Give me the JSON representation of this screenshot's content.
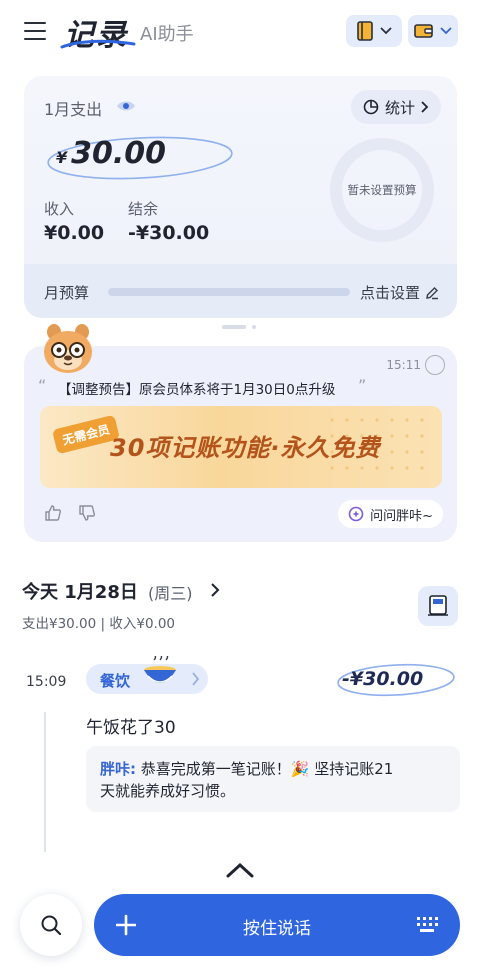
{
  "header": {
    "title": "记录",
    "ai_tab": "AI助手"
  },
  "summary": {
    "expense_label": "1月支出",
    "stats_label": "统计",
    "currency": "¥",
    "expense_amount": "30.00",
    "income_label": "收入",
    "income_value": "¥0.00",
    "balance_label": "结余",
    "balance_value": "-¥30.00",
    "budget_ring_text": "暂未设置预算",
    "monthly_budget_label": "月预算",
    "set_budget_label": "点击设置"
  },
  "assistant_card": {
    "time": "15:11",
    "notice": "【调整预告】原会员体系将于1月30日0点升级",
    "banner_badge": "无需会员",
    "banner_text": "30项记账功能·永久免费",
    "ask_button": "问问胖咔~"
  },
  "day": {
    "title": "今天 1月28日",
    "weekday": "(周三)",
    "summary": "支出¥30.00 | 收入¥0.00"
  },
  "entry": {
    "time": "15:09",
    "category": "餐饮",
    "amount": "-¥30.00",
    "note": "午饭花了30",
    "praise_author": "胖咔:",
    "praise_line1": " 恭喜完成第一笔记账！🎉 坚持记账21",
    "praise_line2": "天就能养成好习惯。"
  },
  "bottom": {
    "voice_label": "按住说话"
  },
  "colors": {
    "accent": "#2f66e0",
    "chip_bg": "#e4ecfb",
    "banner_text": "#b5541a"
  },
  "icons": [
    "menu-icon",
    "notebook-icon",
    "wallet-icon",
    "eye-icon",
    "pie-chart-icon",
    "pencil-icon",
    "check-icon",
    "thumbs-up-icon",
    "thumbs-down-icon",
    "sparkle-icon",
    "calculator-icon",
    "bowl-icon",
    "chevron-up-icon",
    "search-icon",
    "plus-icon",
    "keyboard-icon"
  ]
}
